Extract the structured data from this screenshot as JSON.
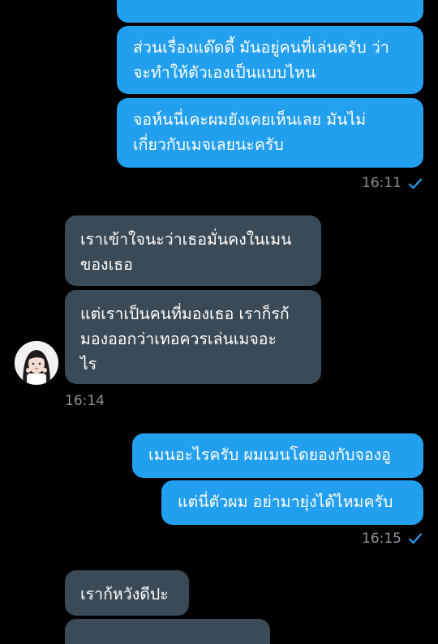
{
  "messages": [
    {
      "id": "m0",
      "dir": "out",
      "text": ""
    },
    {
      "id": "m1",
      "dir": "out",
      "text": "ส่วนเรื่องแด๊ดดี้ มันอยู่คนที่เล่นครับ ว่า\nจะทำให้ตัวเองเป็นแบบไหน"
    },
    {
      "id": "m2",
      "dir": "out",
      "text": "จอห์นนี่เคะผมยังเคยเห็นเลย มันไม่\nเกี่ยวกับเมจเลยนะครับ"
    },
    {
      "id": "m3",
      "dir": "in",
      "text": "เราเข้าใจนะว่าเธอมั่นคงในเมน\nของเธอ"
    },
    {
      "id": "m4",
      "dir": "in",
      "text": "แต่เราเป็นคนที่มองเธอ เราก็รก้\nมองออกว่าเทอควรเล่นเมจอะ\nไร"
    },
    {
      "id": "m5",
      "dir": "out",
      "text": "เมนอะไรครับ ผมเมนโดยองกับจองอู"
    },
    {
      "id": "m6",
      "dir": "out",
      "text": "แต่นี่ตัวผม อย่ามายุ่งได้ไหมครับ"
    },
    {
      "id": "m7",
      "dir": "in",
      "text": "เราก้หวังดีปะ"
    },
    {
      "id": "m8",
      "dir": "in",
      "text": ""
    }
  ],
  "timestamps": {
    "t1": "16:11",
    "t2": "16:14",
    "t3": "16:15"
  },
  "colors": {
    "outgoing_bubble": "#239ff0",
    "incoming_bubble": "#3a4a56",
    "background": "#000000",
    "timestamp": "#8a9199",
    "read_check": "#2b9ef0"
  },
  "icons": {
    "read_receipt": "check-icon",
    "avatar": "profile-photo"
  }
}
